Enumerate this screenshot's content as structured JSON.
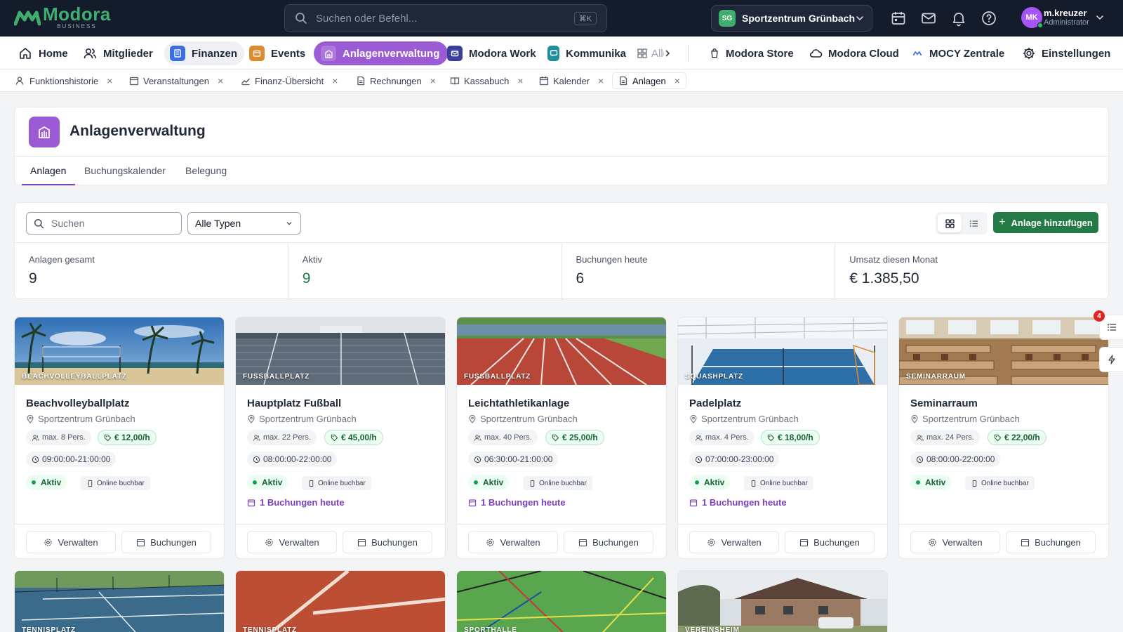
{
  "app": {
    "logo_name": "Modora",
    "logo_sub": "BUSINESS",
    "search_placeholder": "Suchen oder Befehl...",
    "search_shortcut": "⌘K",
    "org_initials": "SG",
    "org_name": "Sportzentrum Grünbach",
    "user_initials": "MK",
    "user_name": "m.kreuzer",
    "user_role": "Administrator"
  },
  "nav": {
    "home": "Home",
    "members": "Mitglieder",
    "finance": "Finanzen",
    "events": "Events",
    "facilities": "Anlagenverwaltung",
    "work": "Modora Work",
    "comm": "Kommunika",
    "all": "Alle",
    "store": "Modora Store",
    "cloud": "Modora Cloud",
    "mocy": "MOCY Zentrale",
    "settings": "Einstellungen"
  },
  "tabs": [
    "Funktionshistorie",
    "Veranstaltungen",
    "Finanz-Übersicht",
    "Rechnungen",
    "Kassabuch",
    "Kalender",
    "Anlagen"
  ],
  "page": {
    "title": "Anlagenverwaltung",
    "subtabs": [
      "Anlagen",
      "Buchungskalender",
      "Belegung"
    ]
  },
  "filters": {
    "search_placeholder": "Suchen",
    "type_value": "Alle Typen",
    "add_label": "Anlage hinzufügen"
  },
  "stats": [
    {
      "label": "Anlagen gesamt",
      "value": "9"
    },
    {
      "label": "Aktiv",
      "value": "9"
    },
    {
      "label": "Buchungen heute",
      "value": "6"
    },
    {
      "label": "Umsatz diesen Monat",
      "value": "€ 1.385,50"
    }
  ],
  "card_labels": {
    "status": "Aktiv",
    "online": "Online buchbar",
    "manage": "Verwalten",
    "bookings": "Buchungen"
  },
  "facilities": [
    {
      "type": "BEACHVOLLEYBALLPLATZ",
      "name": "Beachvolleyballplatz",
      "location": "Sportzentrum Grünbach",
      "capacity": "max. 8 Pers.",
      "price": "€ 12,00/h",
      "hours": "09:00:00-21:00:00",
      "bookings_today": ""
    },
    {
      "type": "FUSSBALLPLATZ",
      "name": "Hauptplatz Fußball",
      "location": "Sportzentrum Grünbach",
      "capacity": "max. 22 Pers.",
      "price": "€ 45,00/h",
      "hours": "08:00:00-22:00:00",
      "bookings_today": "1 Buchungen heute"
    },
    {
      "type": "FUSSBALLPLATZ",
      "name": "Leichtathletikanlage",
      "location": "Sportzentrum Grünbach",
      "capacity": "max. 40 Pers.",
      "price": "€ 25,00/h",
      "hours": "06:30:00-21:00:00",
      "bookings_today": "1 Buchungen heute"
    },
    {
      "type": "SQUASHPLATZ",
      "name": "Padelplatz",
      "location": "Sportzentrum Grünbach",
      "capacity": "max. 4 Pers.",
      "price": "€ 18,00/h",
      "hours": "07:00:00-23:00:00",
      "bookings_today": "1 Buchungen heute"
    },
    {
      "type": "SEMINARRAUM",
      "name": "Seminarraum",
      "location": "Sportzentrum Grünbach",
      "capacity": "max. 24 Pers.",
      "price": "€ 22,00/h",
      "hours": "08:00:00-22:00:00",
      "bookings_today": ""
    },
    {
      "type": "TENNISPLATZ"
    },
    {
      "type": "TENNISPLATZ"
    },
    {
      "type": "SPORTHALLE"
    },
    {
      "type": "VEREINSHEIM"
    }
  ],
  "side": {
    "badge": "4"
  },
  "colors": {
    "brand": "#3fae6e",
    "accent": "#9b5bd4",
    "primary_button": "#237a45",
    "topbar": "#141b2b"
  }
}
